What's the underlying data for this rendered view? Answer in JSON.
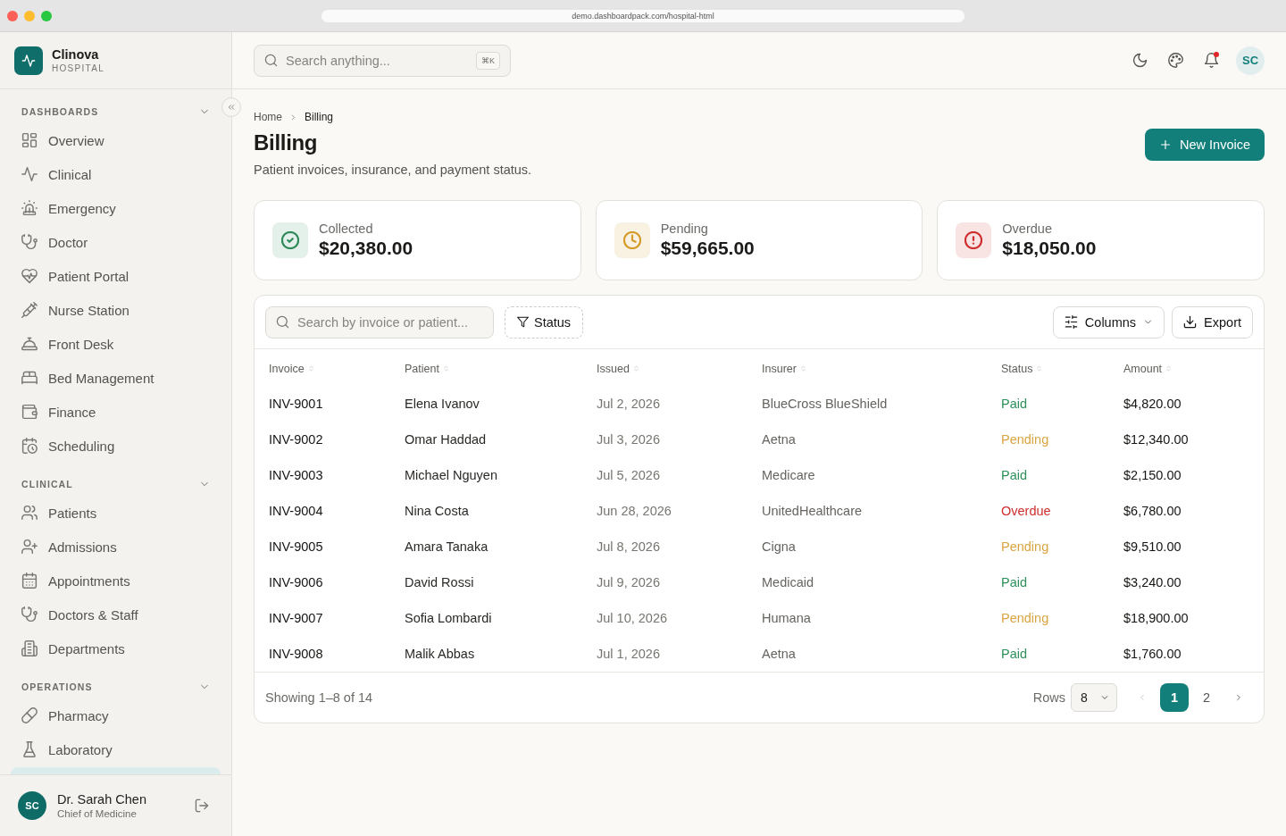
{
  "browser": {
    "url": "demo.dashboardpack.com/hospital-html"
  },
  "sidebar": {
    "brand": {
      "name": "Clinova",
      "tagline": "HOSPITAL"
    },
    "sections": [
      {
        "title": "DASHBOARDS",
        "expanded": true,
        "items": [
          {
            "label": "Overview",
            "selected": false
          },
          {
            "label": "Clinical",
            "selected": false
          },
          {
            "label": "Emergency",
            "selected": false
          },
          {
            "label": "Doctor",
            "selected": false
          },
          {
            "label": "Patient Portal",
            "selected": false
          },
          {
            "label": "Nurse Station",
            "selected": false
          },
          {
            "label": "Front Desk",
            "selected": false
          },
          {
            "label": "Bed Management",
            "selected": false
          },
          {
            "label": "Finance",
            "selected": false
          },
          {
            "label": "Scheduling",
            "selected": false
          }
        ]
      },
      {
        "title": "CLINICAL",
        "expanded": true,
        "items": [
          {
            "label": "Patients",
            "selected": false
          },
          {
            "label": "Admissions",
            "selected": false
          },
          {
            "label": "Appointments",
            "selected": false
          },
          {
            "label": "Doctors & Staff",
            "selected": false
          },
          {
            "label": "Departments",
            "selected": false
          }
        ]
      },
      {
        "title": "OPERATIONS",
        "expanded": true,
        "items": [
          {
            "label": "Pharmacy",
            "selected": false
          },
          {
            "label": "Laboratory",
            "selected": false
          },
          {
            "selected": true
          }
        ]
      }
    ],
    "user": {
      "initials": "SC",
      "name": "Dr. Sarah Chen",
      "role": "Chief of Medicine"
    }
  },
  "topbar": {
    "search": {
      "placeholder": "Search anything...",
      "shortcut": "⌘K"
    },
    "unread_notifications": true,
    "avatar_initials": "SC"
  },
  "page": {
    "breadcrumbs": [
      "Home",
      "Billing"
    ],
    "title": "Billing",
    "subtitle": "Patient invoices, insurance, and payment status.",
    "primary_action": "New Invoice"
  },
  "stats": [
    {
      "kind": "collected",
      "label": "Collected",
      "value": "$20,380.00",
      "color": "#2f8a5a"
    },
    {
      "kind": "pending",
      "label": "Pending",
      "value": "$59,665.00",
      "color": "#d49a2a"
    },
    {
      "kind": "overdue",
      "label": "Overdue",
      "value": "$18,050.00",
      "color": "#cf2e2e"
    }
  ],
  "table": {
    "toolbar": {
      "search_placeholder": "Search by invoice or patient...",
      "filter": "Status",
      "columns_button": "Columns",
      "export_button": "Export"
    },
    "columns": [
      "Invoice",
      "Patient",
      "Issued",
      "Insurer",
      "Status",
      "Amount"
    ],
    "rows": [
      {
        "invoice": "INV-9001",
        "patient": "Elena Ivanov",
        "issued": "Jul 2, 2026",
        "insurer": "BlueCross BlueShield",
        "status": {
          "text": "Paid",
          "color": "#2f8f5b"
        },
        "amount": "$4,820.00"
      },
      {
        "invoice": "INV-9002",
        "patient": "Omar Haddad",
        "issued": "Jul 3, 2026",
        "insurer": "Aetna",
        "status": {
          "text": "Pending",
          "color": "#d9a441"
        },
        "amount": "$12,340.00"
      },
      {
        "invoice": "INV-9003",
        "patient": "Michael Nguyen",
        "issued": "Jul 5, 2026",
        "insurer": "Medicare",
        "status": {
          "text": "Paid",
          "color": "#2f8f5b"
        },
        "amount": "$2,150.00"
      },
      {
        "invoice": "INV-9004",
        "patient": "Nina Costa",
        "issued": "Jun 28, 2026",
        "insurer": "UnitedHealthcare",
        "status": {
          "text": "Overdue",
          "color": "#cf2e2e"
        },
        "amount": "$6,780.00"
      },
      {
        "invoice": "INV-9005",
        "patient": "Amara Tanaka",
        "issued": "Jul 8, 2026",
        "insurer": "Cigna",
        "status": {
          "text": "Pending",
          "color": "#d9a441"
        },
        "amount": "$9,510.00"
      },
      {
        "invoice": "INV-9006",
        "patient": "David Rossi",
        "issued": "Jul 9, 2026",
        "insurer": "Medicaid",
        "status": {
          "text": "Paid",
          "color": "#2f8f5b"
        },
        "amount": "$3,240.00"
      },
      {
        "invoice": "INV-9007",
        "patient": "Sofia Lombardi",
        "issued": "Jul 10, 2026",
        "insurer": "Humana",
        "status": {
          "text": "Pending",
          "color": "#d9a441"
        },
        "amount": "$18,900.00"
      },
      {
        "invoice": "INV-9008",
        "patient": "Malik Abbas",
        "issued": "Jul 1, 2026",
        "insurer": "Aetna",
        "status": {
          "text": "Paid",
          "color": "#2f8f5b"
        },
        "amount": "$1,760.00"
      }
    ],
    "footer": {
      "summary": "Showing 1–8 of 14",
      "rows_label": "Rows",
      "rows_value": "8",
      "prev": {
        "disabled": true
      },
      "next": {
        "disabled": false
      },
      "pages": [
        {
          "label": "1",
          "selected": true
        },
        {
          "label": "2",
          "selected": false
        }
      ]
    }
  }
}
